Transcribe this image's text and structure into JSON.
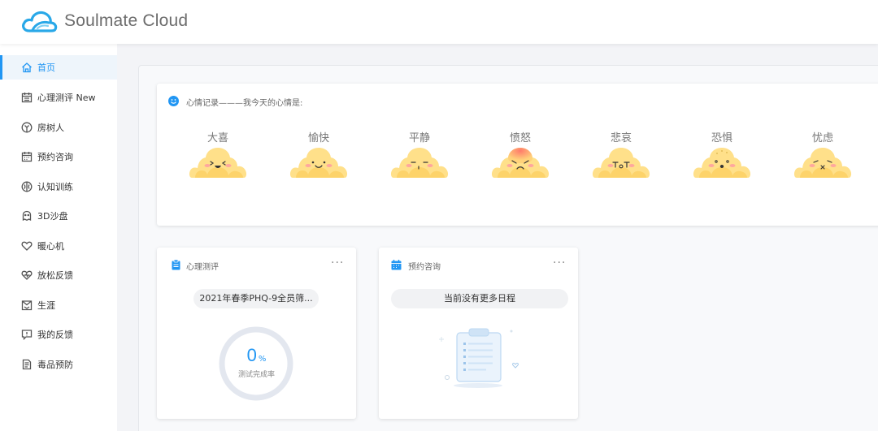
{
  "app": {
    "title": "Soulmate Cloud",
    "brand_color": "#2196f3"
  },
  "sidebar": {
    "items": [
      {
        "label": "首页",
        "icon": "home-icon",
        "active": true
      },
      {
        "label": "心理测评 New",
        "icon": "calendar-icon",
        "active": false
      },
      {
        "label": "房树人",
        "icon": "tree-icon",
        "active": false
      },
      {
        "label": "预约咨询",
        "icon": "schedule-icon",
        "active": false
      },
      {
        "label": "认知训练",
        "icon": "brain-icon",
        "active": false
      },
      {
        "label": "3D沙盘",
        "icon": "sandbox-icon",
        "active": false
      },
      {
        "label": "暖心机",
        "icon": "heart-icon",
        "active": false
      },
      {
        "label": "放松反馈",
        "icon": "relax-heart-icon",
        "active": false
      },
      {
        "label": "生涯",
        "icon": "career-icon",
        "active": false
      },
      {
        "label": "我的反馈",
        "icon": "feedback-icon",
        "active": false
      },
      {
        "label": "毒品预防",
        "icon": "document-icon",
        "active": false
      }
    ]
  },
  "mood": {
    "title": "心情记录———我今天的心情是:",
    "items": [
      {
        "label": "大喜",
        "face": "big-joy"
      },
      {
        "label": "愉快",
        "face": "happy"
      },
      {
        "label": "平静",
        "face": "calm"
      },
      {
        "label": "愤怒",
        "face": "angry"
      },
      {
        "label": "悲哀",
        "face": "sad"
      },
      {
        "label": "恐惧",
        "face": "fear"
      },
      {
        "label": "忧虑",
        "face": "worry"
      }
    ]
  },
  "assessment": {
    "title": "心理测评",
    "more": "···",
    "current_test": "2021年春季PHQ-9全员筛...",
    "completion_value": "0",
    "completion_unit": "%",
    "completion_fraction": 0,
    "completion_label": "测试完成率"
  },
  "appointment": {
    "title": "预约咨询",
    "more": "···",
    "empty_text": "当前没有更多日程"
  }
}
